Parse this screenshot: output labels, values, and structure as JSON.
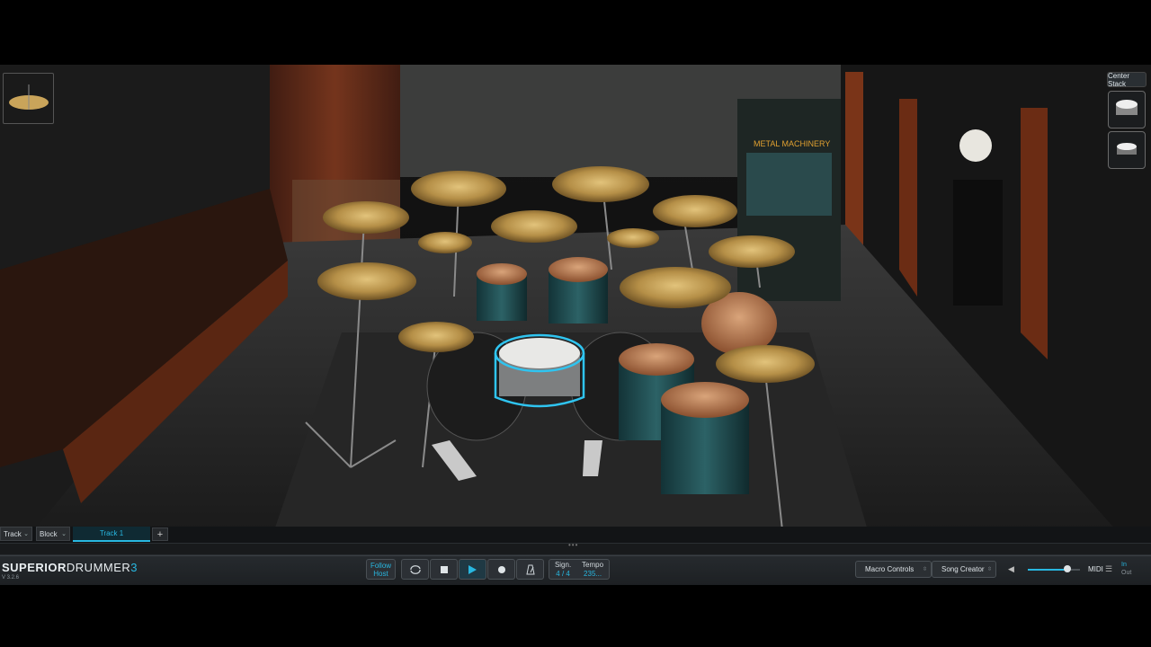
{
  "app": {
    "logo_bold": "SUPERIOR",
    "logo_light": "DRUMMER",
    "logo_num": "3",
    "version": "V 3.2.6"
  },
  "room": {
    "banner_title": "METAL MACHINERY"
  },
  "stack": {
    "label": "Center Stack"
  },
  "tabs": {
    "track_label": "Track",
    "block_label": "Block",
    "active_track": "Track 1",
    "add_label": "+"
  },
  "transport": {
    "follow_host_line1": "Follow",
    "follow_host_line2": "Host",
    "sign_label": "Sign.",
    "sign_value": "4 / 4",
    "tempo_label": "Tempo",
    "tempo_value": "235..."
  },
  "right": {
    "macro_controls": "Macro Controls",
    "song_creator": "Song Creator",
    "midi_label": "MIDI",
    "in_label": "In",
    "out_label": "Out",
    "volume_level": 0.75
  },
  "colors": {
    "accent": "#28b7e0",
    "selection_ring": "#2fc4f0",
    "cymbal": "#c9a45a",
    "drum_shell": "#1f4a4f"
  }
}
